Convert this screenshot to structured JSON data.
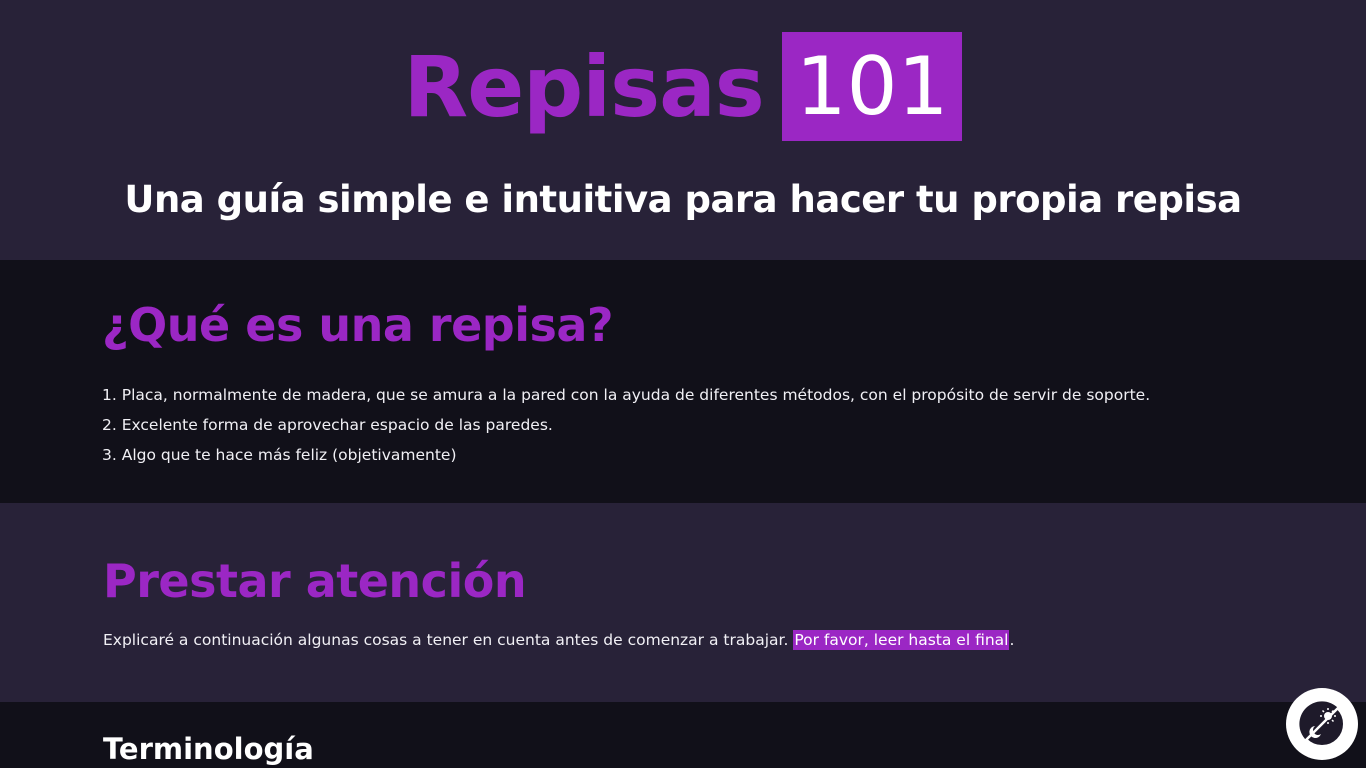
{
  "header": {
    "title_word": "Repisas",
    "title_number": "101",
    "subtitle": "Una guía simple e intuitiva para hacer tu propia repisa"
  },
  "what_is": {
    "heading": "¿Qué es una repisa?",
    "items": [
      "1. Placa, normalmente de madera, que se amura a la pared con la ayuda de diferentes métodos, con el propósito de servir de soporte.",
      "2. Excelente forma de aprovechar espacio de las paredes.",
      "3. Algo que te hace más feliz (objetivamente)"
    ]
  },
  "attention": {
    "heading": "Prestar atención",
    "text": "Explicaré a continuación algunas cosas a tener en cuenta antes de comenzar a trabajar. ",
    "highlight": "Por favor, leer hasta el final",
    "trailing": "."
  },
  "terminology": {
    "heading": "Terminología"
  },
  "theme_toggle": {
    "icon": "dark-mode-toggle-icon"
  },
  "colors": {
    "accent": "#9b27c4",
    "bg_light": "#282238",
    "bg_dark": "#111019",
    "text": "#f1f0f5"
  }
}
